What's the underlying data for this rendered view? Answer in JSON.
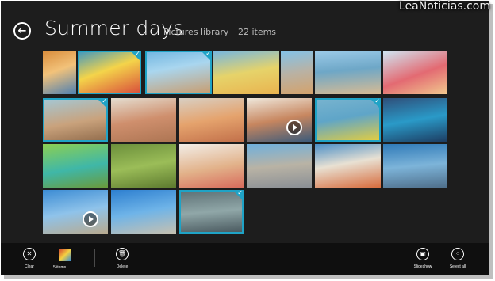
{
  "header": {
    "title": "Summer days",
    "library": "Pictures library",
    "count": "22 items"
  },
  "watermark": "LeaNoticias.com",
  "tiles": [
    {
      "bg": "linear-gradient(160deg,#d98c3b 0%,#f2c27a 45%,#4d7fb1 100%)",
      "selected": false,
      "video": false
    },
    {
      "bg": "linear-gradient(160deg,#3c96c4 0%,#f4d44a 45%,#d84a3b 100%)",
      "selected": true,
      "video": false
    },
    {
      "bg": "linear-gradient(170deg,#6fb4e0 0%,#a9d6ef 40%,#c99b6b 100%)",
      "selected": true,
      "video": false
    },
    {
      "bg": "linear-gradient(170deg,#74b6e2 0%,#e6d36a 50%,#e9b34f 100%)",
      "selected": false,
      "video": false
    },
    {
      "bg": "linear-gradient(170deg,#82c3ea 0%,#b9b2a4 50%,#d4a26b 100%)",
      "selected": false,
      "video": false
    },
    {
      "bg": "linear-gradient(175deg,#9ccbe9 0%,#6ea7c7 45%,#d8bb93 100%)",
      "selected": false,
      "video": false
    },
    {
      "bg": "linear-gradient(160deg,#cfe7f4 0%,#e36a72 55%,#f1c98e 100%)",
      "selected": false,
      "video": false
    },
    {
      "bg": "linear-gradient(170deg,#a3c9d8 0%,#c9a27c 55%,#8f6a4a 100%)",
      "selected": true,
      "video": false
    },
    {
      "bg": "linear-gradient(170deg,#e4ddd0 0%,#cf8f6d 50%,#ad7553 100%)",
      "selected": false,
      "video": false
    },
    {
      "bg": "linear-gradient(170deg,#d8cfc3 0%,#e5a36d 50%,#c2704a 100%)",
      "selected": false,
      "video": false
    },
    {
      "bg": "linear-gradient(170deg,#efe8dc 0%,#c7865f 50%,#3b5a7a 100%)",
      "selected": false,
      "video": true
    },
    {
      "bg": "linear-gradient(170deg,#79b4cf 0%,#5fa5c8 45%,#e9cf3a 100%)",
      "selected": true,
      "video": false
    },
    {
      "bg": "linear-gradient(170deg,#2f4f7a 0%,#2a9ac8 50%,#1d3c61 100%)",
      "selected": false,
      "video": false
    },
    {
      "bg": "linear-gradient(170deg,#8ccf52 0%,#3fb7a8 55%,#6a9a3b 100%)",
      "selected": false,
      "video": false
    },
    {
      "bg": "linear-gradient(170deg,#6b8f3b 0%,#9bbd58 50%,#5d7a2f 100%)",
      "selected": false,
      "video": false
    },
    {
      "bg": "linear-gradient(170deg,#f2eee8 0%,#e2b28a 55%,#d86b5c 100%)",
      "selected": false,
      "video": false
    },
    {
      "bg": "linear-gradient(175deg,#6fb0dd 0%,#b9b3a5 50%,#8a8f95 100%)",
      "selected": false,
      "video": false
    },
    {
      "bg": "linear-gradient(170deg,#4a8fc7 0%,#e8e1d3 45%,#d76c3d 100%)",
      "selected": false,
      "video": false
    },
    {
      "bg": "linear-gradient(175deg,#2f7ab8 0%,#7db4d9 50%,#4f6f8b 100%)",
      "selected": false,
      "video": false
    },
    {
      "bg": "linear-gradient(170deg,#3c8cd4 0%,#8fc3ea 50%,#b8aa8f 100%)",
      "selected": false,
      "video": true
    },
    {
      "bg": "linear-gradient(170deg,#2d7fd0 0%,#6fb4e8 50%,#c6c0b0 100%)",
      "selected": false,
      "video": false
    },
    {
      "bg": "linear-gradient(175deg,#5b6e73 0%,#90a7a8 50%,#45545a 100%)",
      "selected": true,
      "video": false
    }
  ],
  "appbar": {
    "clear_label": "Clear",
    "selection_label": "5 items",
    "delete_label": "Delete",
    "slideshow_label": "Slideshow",
    "select_all_label": "Select all"
  }
}
